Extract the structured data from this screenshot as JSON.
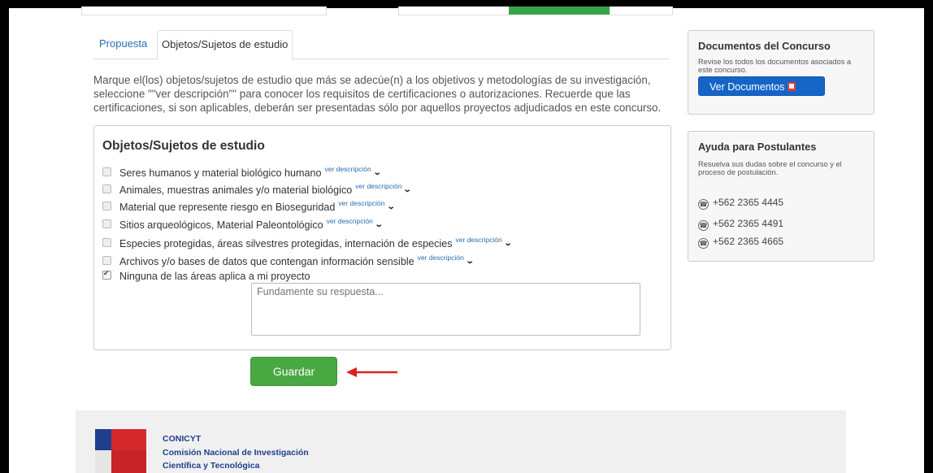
{
  "tabs": [
    {
      "label": "Propuesta"
    },
    {
      "label": "Objetos/Sujetos de estudio"
    }
  ],
  "intro": "Marque el(los) objetos/sujetos de estudio que más se adecúe(n) a los objetivos y metodologías de su investigación, seleccione \"\"ver descripción\"\" para conocer los requisitos de certificaciones o autorizaciones. Recuerde que las certificaciones, si son aplicables, deberán ser presentadas sólo por aquellos proyectos adjudicados en este concurso.",
  "panel": {
    "title": "Objetos/Sujetos de estudio",
    "desc_link": "ver descripción",
    "options": [
      {
        "label": "Seres humanos y material biológico humano",
        "checked": false
      },
      {
        "label": "Animales, muestras animales y/o material biológico",
        "checked": false
      },
      {
        "label": "Material que represente riesgo en Bioseguridad",
        "checked": false
      },
      {
        "label": "Sitios arqueológicos, Material Paleontológico",
        "checked": false
      },
      {
        "label": "Especies protegidas, áreas silvestres protegidas, internación de especies",
        "checked": false
      },
      {
        "label": "Archivos y/o bases de datos que contengan información sensible",
        "checked": false
      },
      {
        "label": "Ninguna de las áreas aplica a mi proyecto",
        "checked": true
      }
    ],
    "textarea_placeholder": "Fundamente su respuesta..."
  },
  "save_label": "Guardar",
  "docs_box": {
    "title": "Documentos del Concurso",
    "text": "Revise los todos los documentos asociados a este concurso.",
    "button": "Ver Documentos"
  },
  "help_box": {
    "title": "Ayuda para Postulantes",
    "text": "Resuelva sus dudas sobre el concurso y el proceso de postulación.",
    "phones": [
      "+562 2365 4445",
      "+562 2365 4491",
      "+562 2365 4665"
    ]
  },
  "footer": {
    "org": "CONICYT",
    "line1": "Comisión Nacional de Investigación",
    "line2": "Científica y Tecnológica"
  },
  "colors": {
    "save_green": "#4aa843",
    "doc_blue": "#1565c8",
    "arrow_red": "#e02020",
    "link_blue": "#2a6db0"
  }
}
